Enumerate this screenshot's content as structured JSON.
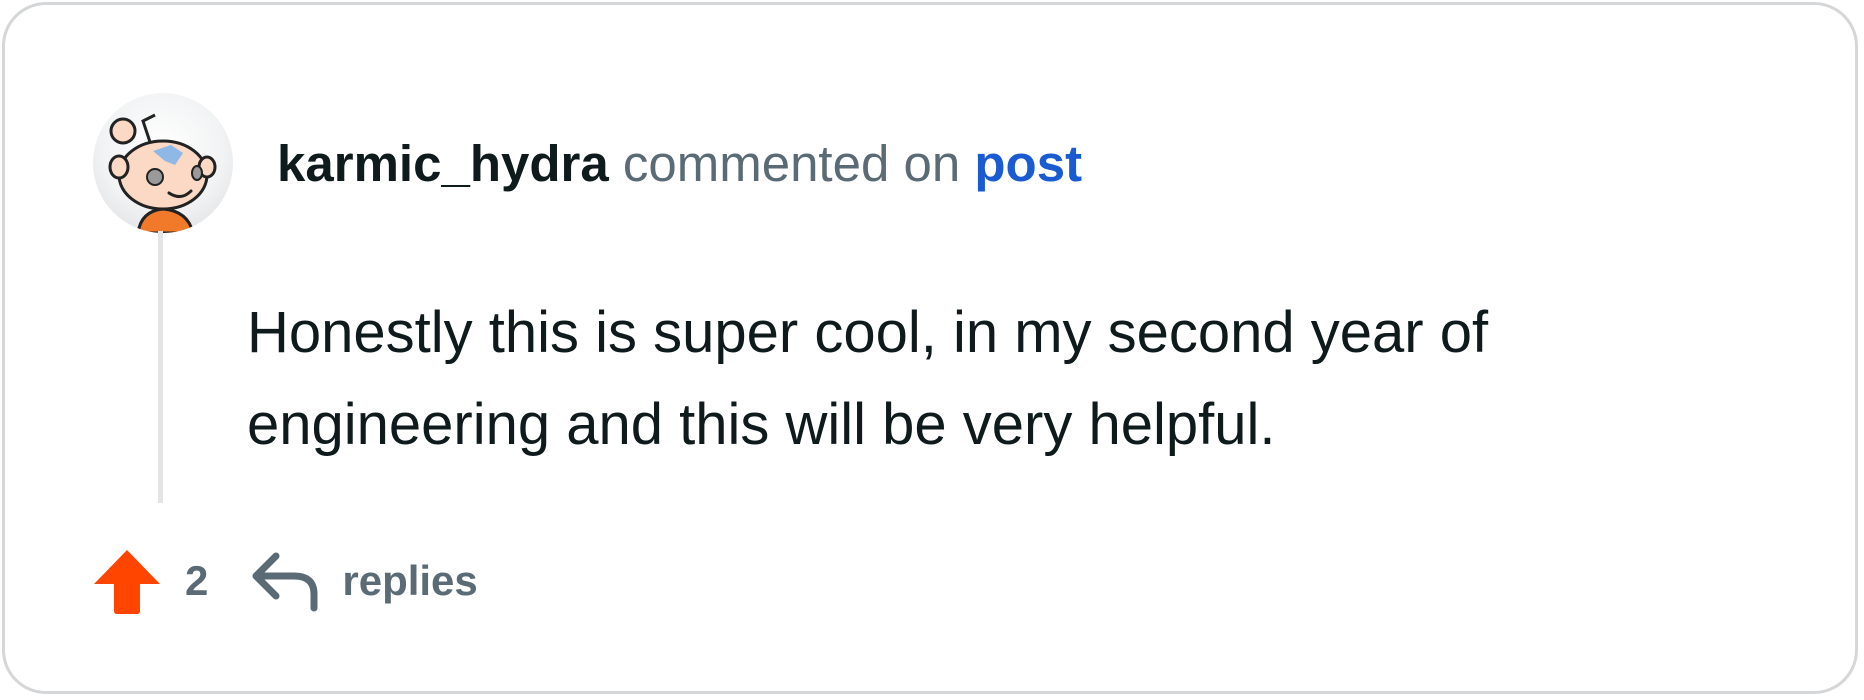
{
  "comment": {
    "author": "karmic_hydra",
    "action_text": "commented on",
    "link_text": "post",
    "body": "Honestly this is super cool, in my second year of engineering and this will be very helpful."
  },
  "actions": {
    "vote_count": "2",
    "replies_label": "replies"
  },
  "icons": {
    "avatar": "snoo-avatar",
    "upvote": "upvote-arrow-icon",
    "reply": "reply-arrow-icon"
  },
  "colors": {
    "upvote": "#ff4500",
    "link": "#1a5bd1",
    "muted": "#5b6b75",
    "text": "#0f1a1c",
    "border": "#d4d6d8"
  }
}
